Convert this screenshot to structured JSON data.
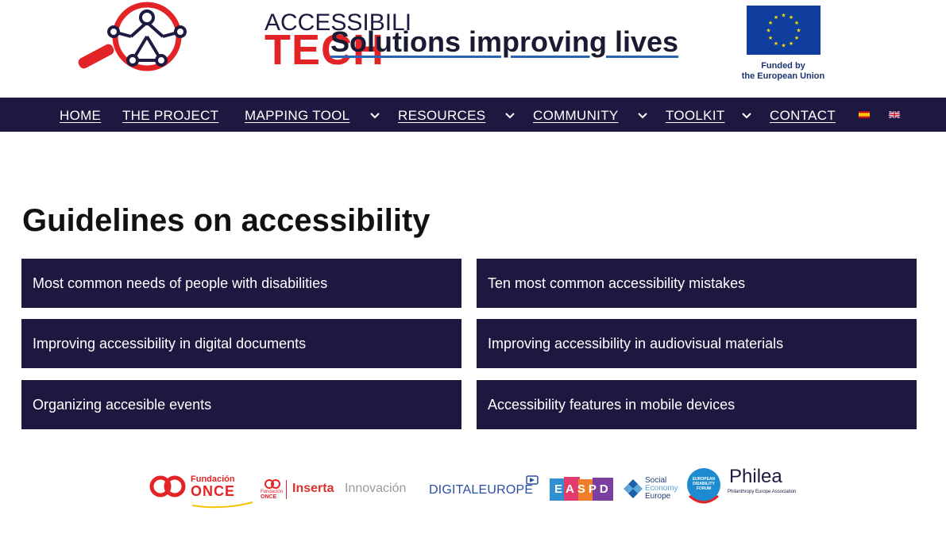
{
  "header": {
    "logo_top": "ACCESSIBILI",
    "logo_bottom": "TECH",
    "tagline": "Solutions improving lives",
    "eu_line1": "Funded by",
    "eu_line2": "the European Union"
  },
  "nav": {
    "items": [
      {
        "label": "HOME",
        "dropdown": false
      },
      {
        "label": "THE PROJECT",
        "dropdown": false
      },
      {
        "label": "MAPPING TOOL",
        "dropdown": true
      },
      {
        "label": "RESOURCES",
        "dropdown": true
      },
      {
        "label": "COMMUNITY",
        "dropdown": true
      },
      {
        "label": "TOOLKIT",
        "dropdown": true
      },
      {
        "label": "CONTACT",
        "dropdown": false
      }
    ]
  },
  "main": {
    "title": "Guidelines on accessibility",
    "cards": [
      "Most common needs of people with disabilities",
      "Ten most common accessibility mistakes",
      "Improving accessibility in digital documents",
      "Improving accessibility in audiovisual materials",
      "Organizing accesible events",
      "Accessibility features in mobile devices"
    ]
  },
  "partners": {
    "fundacion_once_1": "Fundación",
    "fundacion_once_2": "ONCE",
    "small_once_1": "Fundación",
    "small_once_2": "ONCE",
    "inserta": "Inserta",
    "innovacion": "Innovación",
    "digitaleurope": "DIGITALEUROPE",
    "easpd": "EASPD",
    "see_1": "Social",
    "see_2": "Economy",
    "see_3": "Europe",
    "edf": "EUROPEAN DISABILITY FORUM",
    "philea": "Philea",
    "philea_sub": "Philanthropy Europe Association"
  },
  "colors": {
    "navy": "#1c1840",
    "logo_red": "#e32427",
    "eu_blue": "#0f3e9e",
    "eu_star": "#ffdd00"
  }
}
